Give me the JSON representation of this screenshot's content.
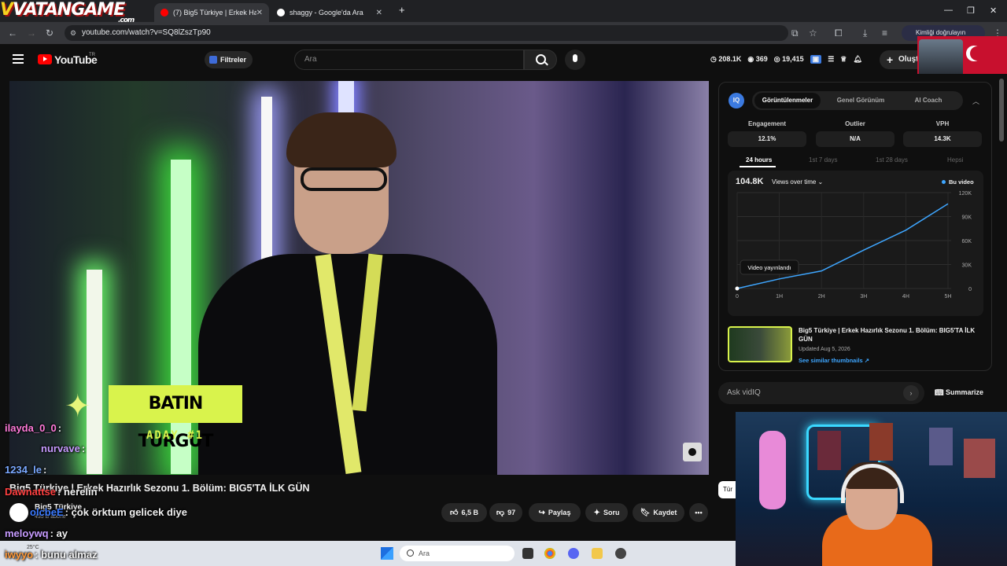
{
  "browser": {
    "overlay_logo": "VATANGAME",
    "overlay_logo_sub": ".com",
    "tabs": [
      {
        "title": "(7) Big5 Türkiye | Erkek Hazırlık",
        "active": true
      },
      {
        "title": "shaggy - Google'da Ara",
        "active": false
      }
    ],
    "new_tab": "+",
    "url": "youtube.com/watch?v=SQ8lZszTp90",
    "profile_label": "Kimliği doğrulayın"
  },
  "youtube": {
    "logo_text": "YouTube",
    "region": "TR",
    "filters_label": "Filtreler",
    "search_placeholder": "Ara",
    "stats": {
      "clock": "208.1K",
      "views": "369",
      "eye": "19,415"
    },
    "create_label": "Oluştur"
  },
  "video": {
    "lower_third_name": "BATIN TURGUT",
    "lower_third_sub": "ADAY #1",
    "title": "Big5 Türkiye | Erkek Hazırlık Sezonu 1. Bölüm: BIG5'TA İLK GÜN",
    "channel_name": "Big5 Türkiye",
    "channel_subs": "435 B abone",
    "actions": {
      "likes": "6,5 B",
      "comments": "97",
      "share": "Paylaş",
      "ask": "Soru",
      "save": "Kaydet",
      "more": "•••"
    }
  },
  "vidiq": {
    "logo": "IQ",
    "tabs": [
      "Görüntülenmeler",
      "Genel Görünüm",
      "AI Coach"
    ],
    "metrics": [
      {
        "label": "Engagement",
        "value": "12.1%"
      },
      {
        "label": "Outlier",
        "value": "N/A"
      },
      {
        "label": "VPH",
        "value": "14.3K"
      }
    ],
    "ranges": [
      "24 hours",
      "1st 7 days",
      "1st 28 days",
      "Hepsi"
    ],
    "chart_total": "104.8K",
    "chart_mode": "Views over time",
    "legend": "Bu video",
    "tooltip": "Video yayınlandı",
    "thumb_title": "Big5 Türkiye | Erkek Hazırlık Sezonu 1. Bölüm: BIG5'TA İLK GÜN",
    "thumb_updated": "Updated Aug 5, 2026",
    "thumb_link": "See similar thumbnails ↗",
    "ask_placeholder": "Ask vidIQ",
    "summarize": "Summarize",
    "side_chip": "Tür"
  },
  "chart_data": {
    "type": "line",
    "x": [
      "0",
      "1H",
      "2H",
      "3H",
      "4H",
      "5H"
    ],
    "series": [
      {
        "name": "Bu video",
        "values": [
          0,
          12,
          22,
          48,
          73,
          106
        ]
      }
    ],
    "y_ticks": [
      "0",
      "30K",
      "60K",
      "90K",
      "120K"
    ],
    "ylim": [
      0,
      120
    ],
    "ylabel": "",
    "xlabel": "",
    "grid": true,
    "legend": "top-right",
    "color": "#3ea6ff"
  },
  "chat": [
    {
      "user": "ilayda_0_0",
      "msg": ":",
      "color": "#ff7ad9"
    },
    {
      "user": "nurvave",
      "msg": ":",
      "color": "#c79bff"
    },
    {
      "user": "1234_le",
      "msg": ":",
      "color": "#7aa8ff"
    },
    {
      "user": "Dawnattse",
      "msg": ": nerelin",
      "color": "#ff4040"
    },
    {
      "user": "olcbeE",
      "msg": ": çok örktum gelicek diye",
      "color": "#3a7aff"
    },
    {
      "user": "meloywq",
      "msg": ": ay",
      "color": "#c79bff"
    },
    {
      "user": "iwyyo",
      "msg": ": bunu almaz",
      "color": "#ff9a3a"
    }
  ],
  "taskbar": {
    "weather": "25°C",
    "search": "Ara"
  }
}
